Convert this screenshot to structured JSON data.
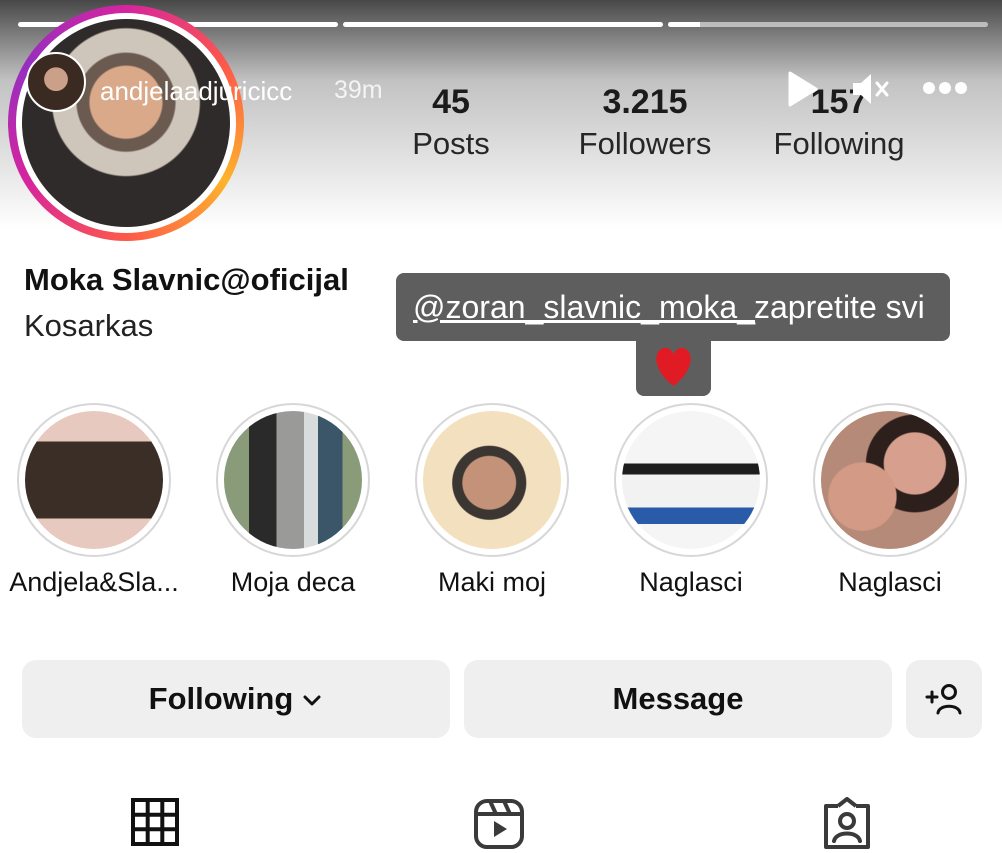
{
  "story": {
    "username": "andjelaadjuricicc",
    "time_ago": "39m",
    "progress": [
      1.0,
      1.0,
      0.1
    ]
  },
  "profile": {
    "display_name": "Moka Slavnic@oficijal",
    "bio": "Kosarkas",
    "stats": [
      {
        "value": "45",
        "label": "Posts"
      },
      {
        "value": "3.215",
        "label": "Followers"
      },
      {
        "value": "157",
        "label": "Following"
      }
    ]
  },
  "stickers": {
    "mention": "@zoran_slavnic_moka_",
    "text": "zapretite svi",
    "emoji": "❤️"
  },
  "highlights": [
    {
      "label": "Andjela&Sla..."
    },
    {
      "label": "Moja deca"
    },
    {
      "label": "Maki moj"
    },
    {
      "label": "Naglasci"
    },
    {
      "label": "Naglasci"
    }
  ],
  "actions": {
    "following_label": "Following",
    "message_label": "Message"
  },
  "icons": [
    "play-icon",
    "mute-icon",
    "more-icon",
    "chevron-down-icon",
    "add-person-icon",
    "grid-icon",
    "reels-icon",
    "tagged-icon"
  ],
  "colors": {
    "story_ring": "#d6249f",
    "button_bg": "#efefef",
    "sticker_bg": "#5e5e5e"
  }
}
